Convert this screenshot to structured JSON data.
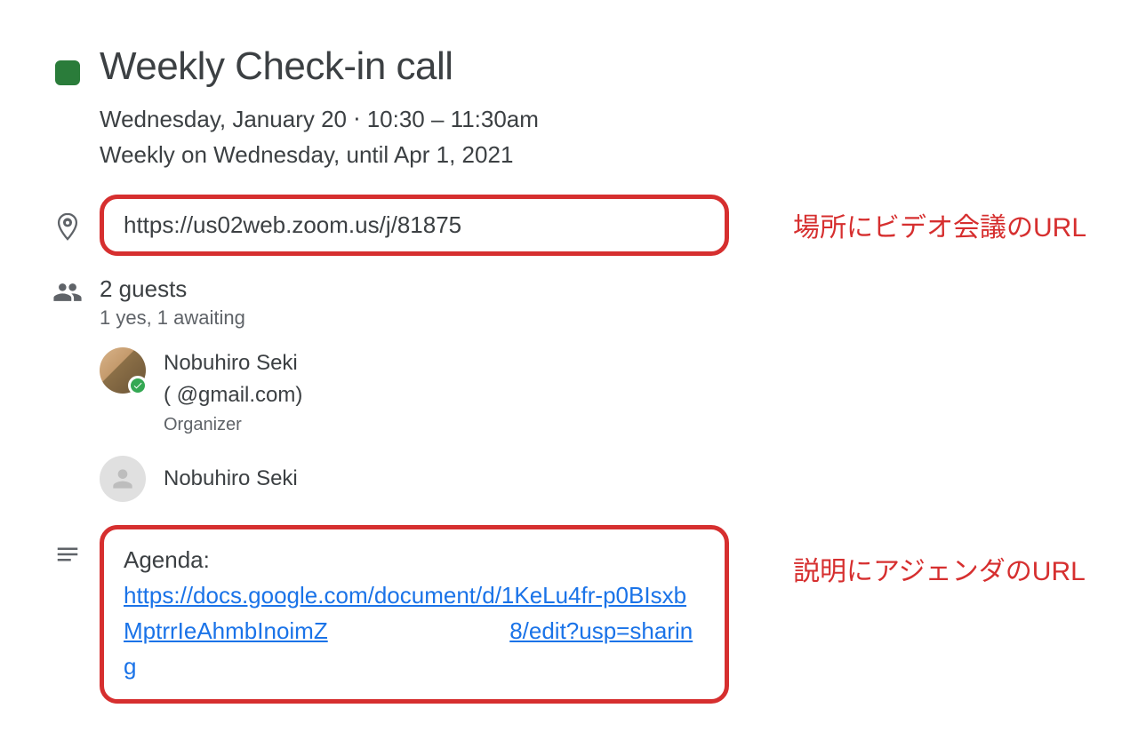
{
  "event": {
    "color": "#2a7c3a",
    "title": "Weekly Check-in call",
    "date_line": "Wednesday, January 20  ⋅  10:30 – 11:30am",
    "recurrence": "Weekly on Wednesday, until Apr 1, 2021"
  },
  "location": {
    "url_text": "https://us02web.zoom.us/j/81875"
  },
  "guests": {
    "summary": "2 guests",
    "status": "1 yes, 1 awaiting",
    "list": [
      {
        "name": "Nobuhiro Seki",
        "email_display": "(               @gmail.com)",
        "role": "Organizer",
        "accepted": true,
        "has_photo": true
      },
      {
        "name": "Nobuhiro Seki",
        "email_display": "",
        "role": "",
        "accepted": false,
        "has_photo": false
      }
    ]
  },
  "description": {
    "label": "Agenda:",
    "link_line1": "https://docs.google.com/document/d/1KeLu4fr-p0BIsxbMptrrIeAhmbInoimZ",
    "link_line2": "8/edit?usp=sharing"
  },
  "annotations": {
    "location": "場所にビデオ会議のURL",
    "description": "説明にアジェンダのURL"
  }
}
